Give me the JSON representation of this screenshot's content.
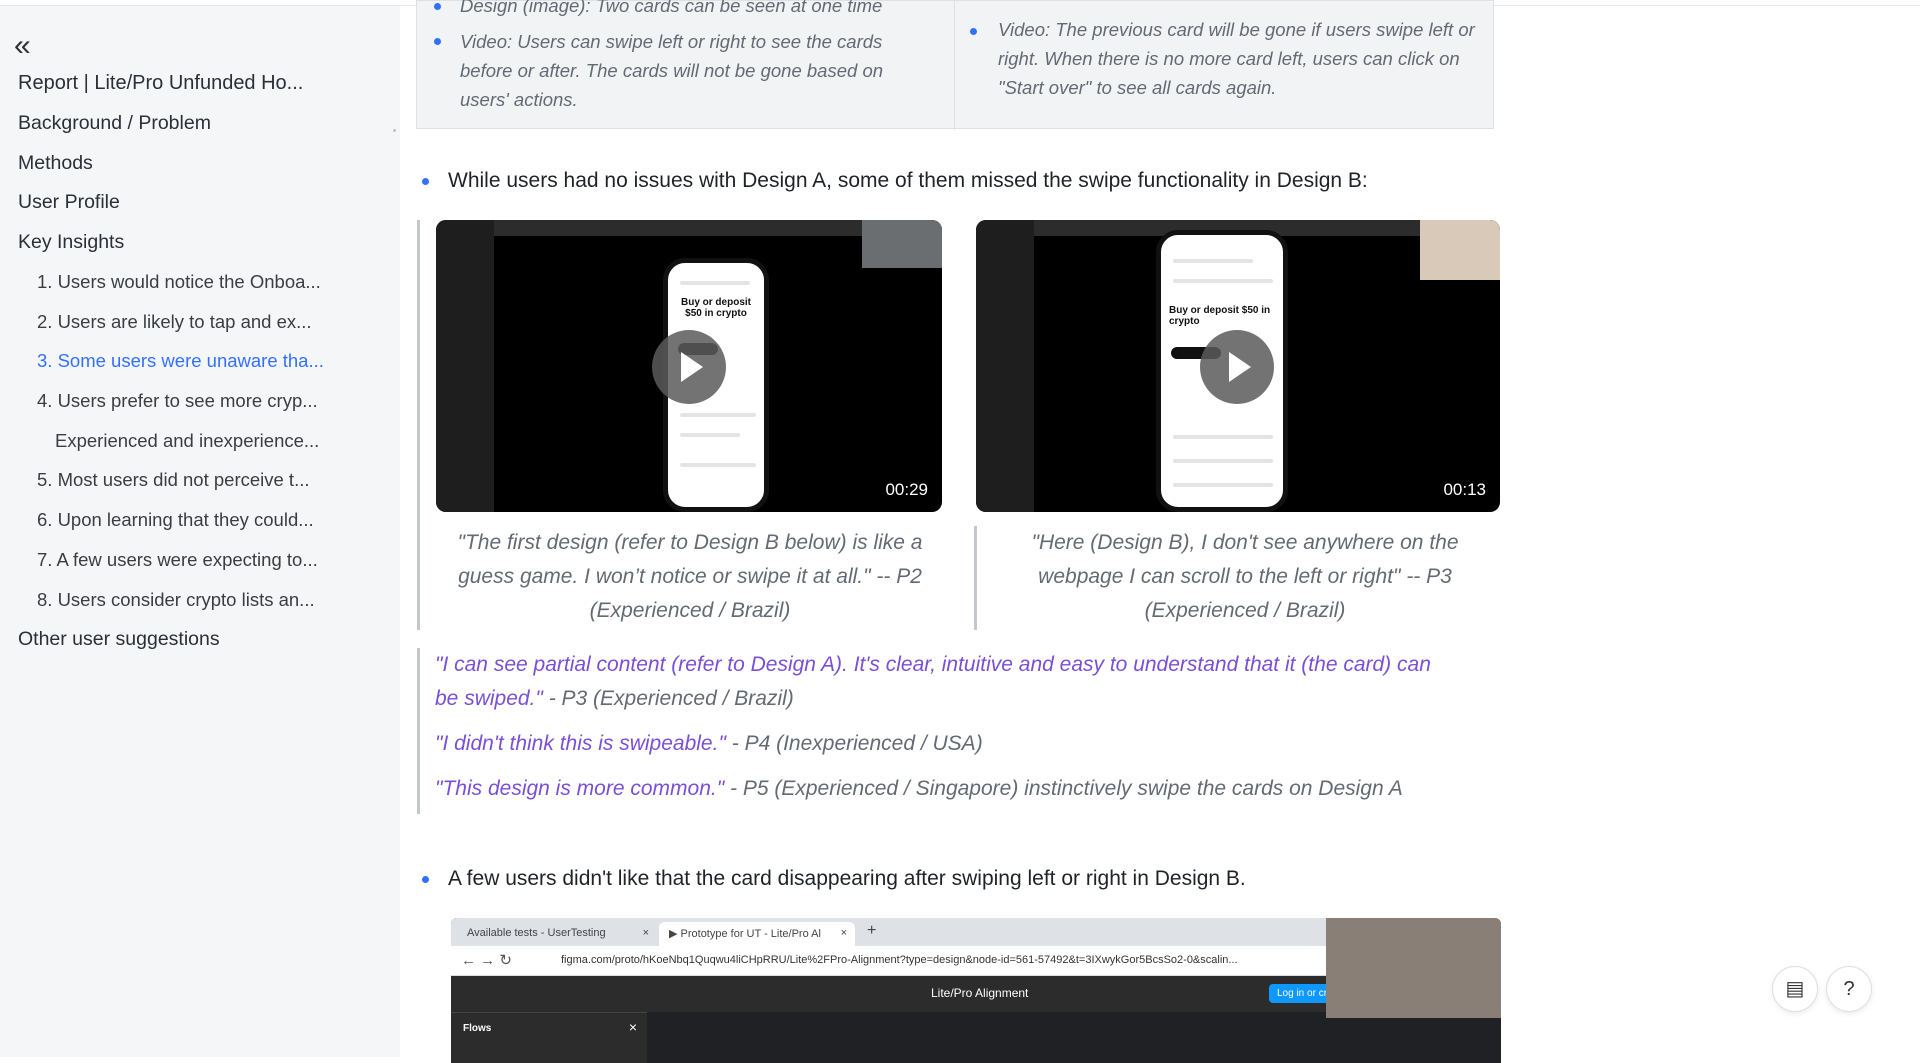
{
  "sidebar": {
    "collapse_glyph": "«",
    "items": [
      {
        "label": "Report | Lite/Pro Unfunded Ho...",
        "level": 1
      },
      {
        "label": "Background / Problem",
        "level": 1
      },
      {
        "label": "Methods",
        "level": 1
      },
      {
        "label": "User Profile",
        "level": 1
      },
      {
        "label": "Key Insights",
        "level": 1
      },
      {
        "label": "1. Users would notice the Onboa...",
        "level": 2
      },
      {
        "label": "2. Users are likely to tap and ex...",
        "level": 2
      },
      {
        "label": "3. Some users were unaware tha...",
        "level": 2,
        "active": true
      },
      {
        "label": "4. Users prefer to see more cryp...",
        "level": 2
      },
      {
        "label": "Experienced and inexperience...",
        "level": 3
      },
      {
        "label": "5. Most users did not perceive t...",
        "level": 2
      },
      {
        "label": "6. Upon learning that they could...",
        "level": 2
      },
      {
        "label": "7. A few users were expecting to...",
        "level": 2
      },
      {
        "label": "8. Users consider crypto lists an...",
        "level": 2
      },
      {
        "label": "Other user suggestions",
        "level": 1
      }
    ]
  },
  "table": {
    "left_cut": "Design (image): Two cards can be seen at one time",
    "left_video": "Video: Users can swipe left or right to see the cards before or after. The cards will not be gone based on users' actions.",
    "right_video": "Video: The previous card will be gone if users swipe left or right. When there is no more card left, users can click on \"Start over\" to see all cards again."
  },
  "bullet1": "While users had no issues with Design A, some of them missed the swipe functionality in Design B:",
  "videos": [
    {
      "duration": "00:29",
      "phone_title": "Buy or deposit $50 in crypto",
      "caption": "\"The first design (refer to Design B below) is like a guess game. I won’t notice or swipe it at all.\" -- P2 (Experienced / Brazil)"
    },
    {
      "duration": "00:13",
      "phone_title": "Buy or deposit $50 in crypto",
      "caption": "\"Here (Design B), I don't see anywhere on the webpage I can scroll to the left or right\" -- P3 (Experienced / Brazil)"
    }
  ],
  "quotes": [
    {
      "q1": "\"I can see partial content (refer to Design A). It's clear, intuitive and easy to understand that it (the card) can",
      "q2": "be swiped.\"",
      "attr": " - P3 (Experienced / Brazil)"
    },
    {
      "q": "\"I didn't think this is swipeable.\"",
      "attr": " - P4 (Inexperienced / USA)"
    },
    {
      "q": "\"This design is more common.\"",
      "attr": " - P5 (Experienced / Singapore) instinctively swipe the cards on Design A"
    }
  ],
  "bullet2": "A few users didn't like that the card disappearing after swiping left or right in Design B.",
  "browser": {
    "tab1": "Available tests - UserTesting",
    "tab2": "▶ Prototype for UT - Lite/Pro Al",
    "url": "figma.com/proto/hKoeNbq1Quqwu4liCHpRRU/Lite%2FPro-Alignment?type=design&node-id=561-57492&t=3IXwykGor5BcsSo2-0&scalin...",
    "figma_title": "Lite/Pro Alignment",
    "login": "Log in or cre",
    "flows": "Flows"
  },
  "colors": {
    "accent": "#3370ff",
    "quote_purple": "#7a4fd6"
  }
}
